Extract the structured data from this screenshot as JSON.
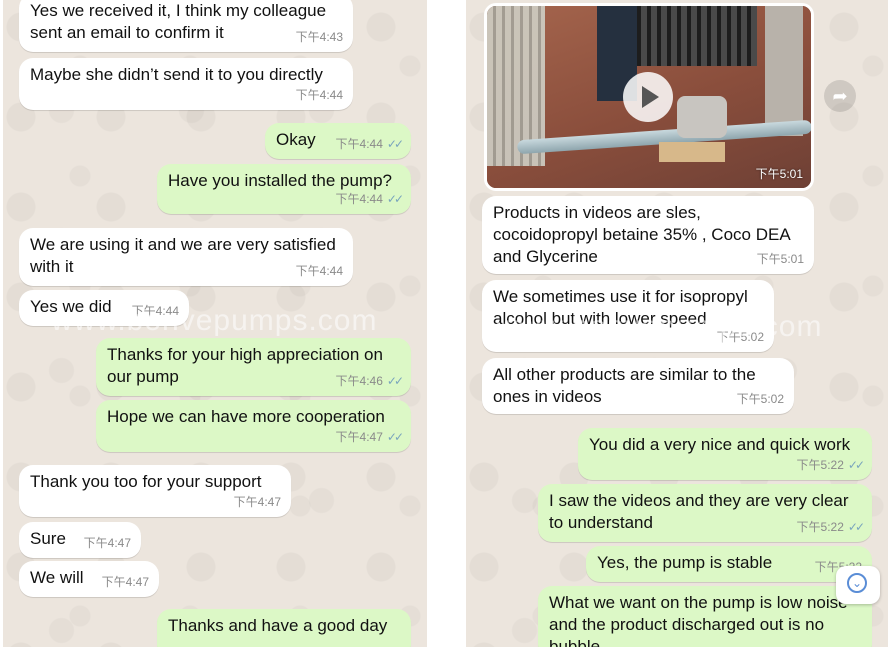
{
  "watermark": "www.bonvepumps.com",
  "left_chat": {
    "messages": [
      {
        "dir": "in",
        "text": "Yes we received it, I think my colleague sent an email to confirm it",
        "time": "下午4:43"
      },
      {
        "dir": "in",
        "text": "Maybe she didn’t send it to you directly",
        "time": "下午4:44"
      },
      {
        "dir": "out",
        "text": "Okay",
        "time": "下午4:44"
      },
      {
        "dir": "out",
        "text": "Have you installed the pump?",
        "time": "下午4:44"
      },
      {
        "dir": "in",
        "text": "We are using it and we are very satisfied with it",
        "time": "下午4:44"
      },
      {
        "dir": "in",
        "text": "Yes we did",
        "time": "下午4:44"
      },
      {
        "dir": "out",
        "text": "Thanks for your high appreciation on our pump",
        "time": "下午4:46"
      },
      {
        "dir": "out",
        "text": "Hope we can have more cooperation",
        "time": "下午4:47"
      },
      {
        "dir": "in",
        "text": "Thank you too for your support",
        "time": "下午4:47"
      },
      {
        "dir": "in",
        "text": "Sure",
        "time": "下午4:47"
      },
      {
        "dir": "in",
        "text": "We will",
        "time": "下午4:47"
      },
      {
        "dir": "out",
        "text": "Thanks and have a good day",
        "time": ""
      }
    ]
  },
  "right_chat": {
    "video": {
      "time": "下午5:01",
      "play_icon": "play-icon"
    },
    "forward_icon": "forward-icon",
    "messages": [
      {
        "dir": "in",
        "text": "Products in videos are sles, cocoidopropyl betaine 35% , Coco DEA and Glycerine",
        "time": "下午5:01"
      },
      {
        "dir": "in",
        "text": "We sometimes use it for isopropyl alcohol but with lower speed",
        "time": "下午5:02"
      },
      {
        "dir": "in",
        "text": "All other products are similar to the ones in videos",
        "time": "下午5:02"
      },
      {
        "dir": "out",
        "text": "You did a very nice and quick work",
        "time": "下午5:22"
      },
      {
        "dir": "out",
        "text": "I saw the videos and they are very clear to understand",
        "time": "下午5:22"
      },
      {
        "dir": "out",
        "text": "Yes, the pump is stable",
        "time": "下午5:22"
      },
      {
        "dir": "out",
        "text": "What we want on the pump is low noise and the product discharged out is no bubble",
        "time": ""
      }
    ]
  },
  "colors": {
    "incoming": "#ffffff",
    "outgoing": "#dcf8c6",
    "background": "#ece5dd",
    "read_check": "#7aa5bd"
  },
  "read_receipt_icon": "double-check-icon",
  "scroll_down_icon": "chevron-down-circle-icon"
}
